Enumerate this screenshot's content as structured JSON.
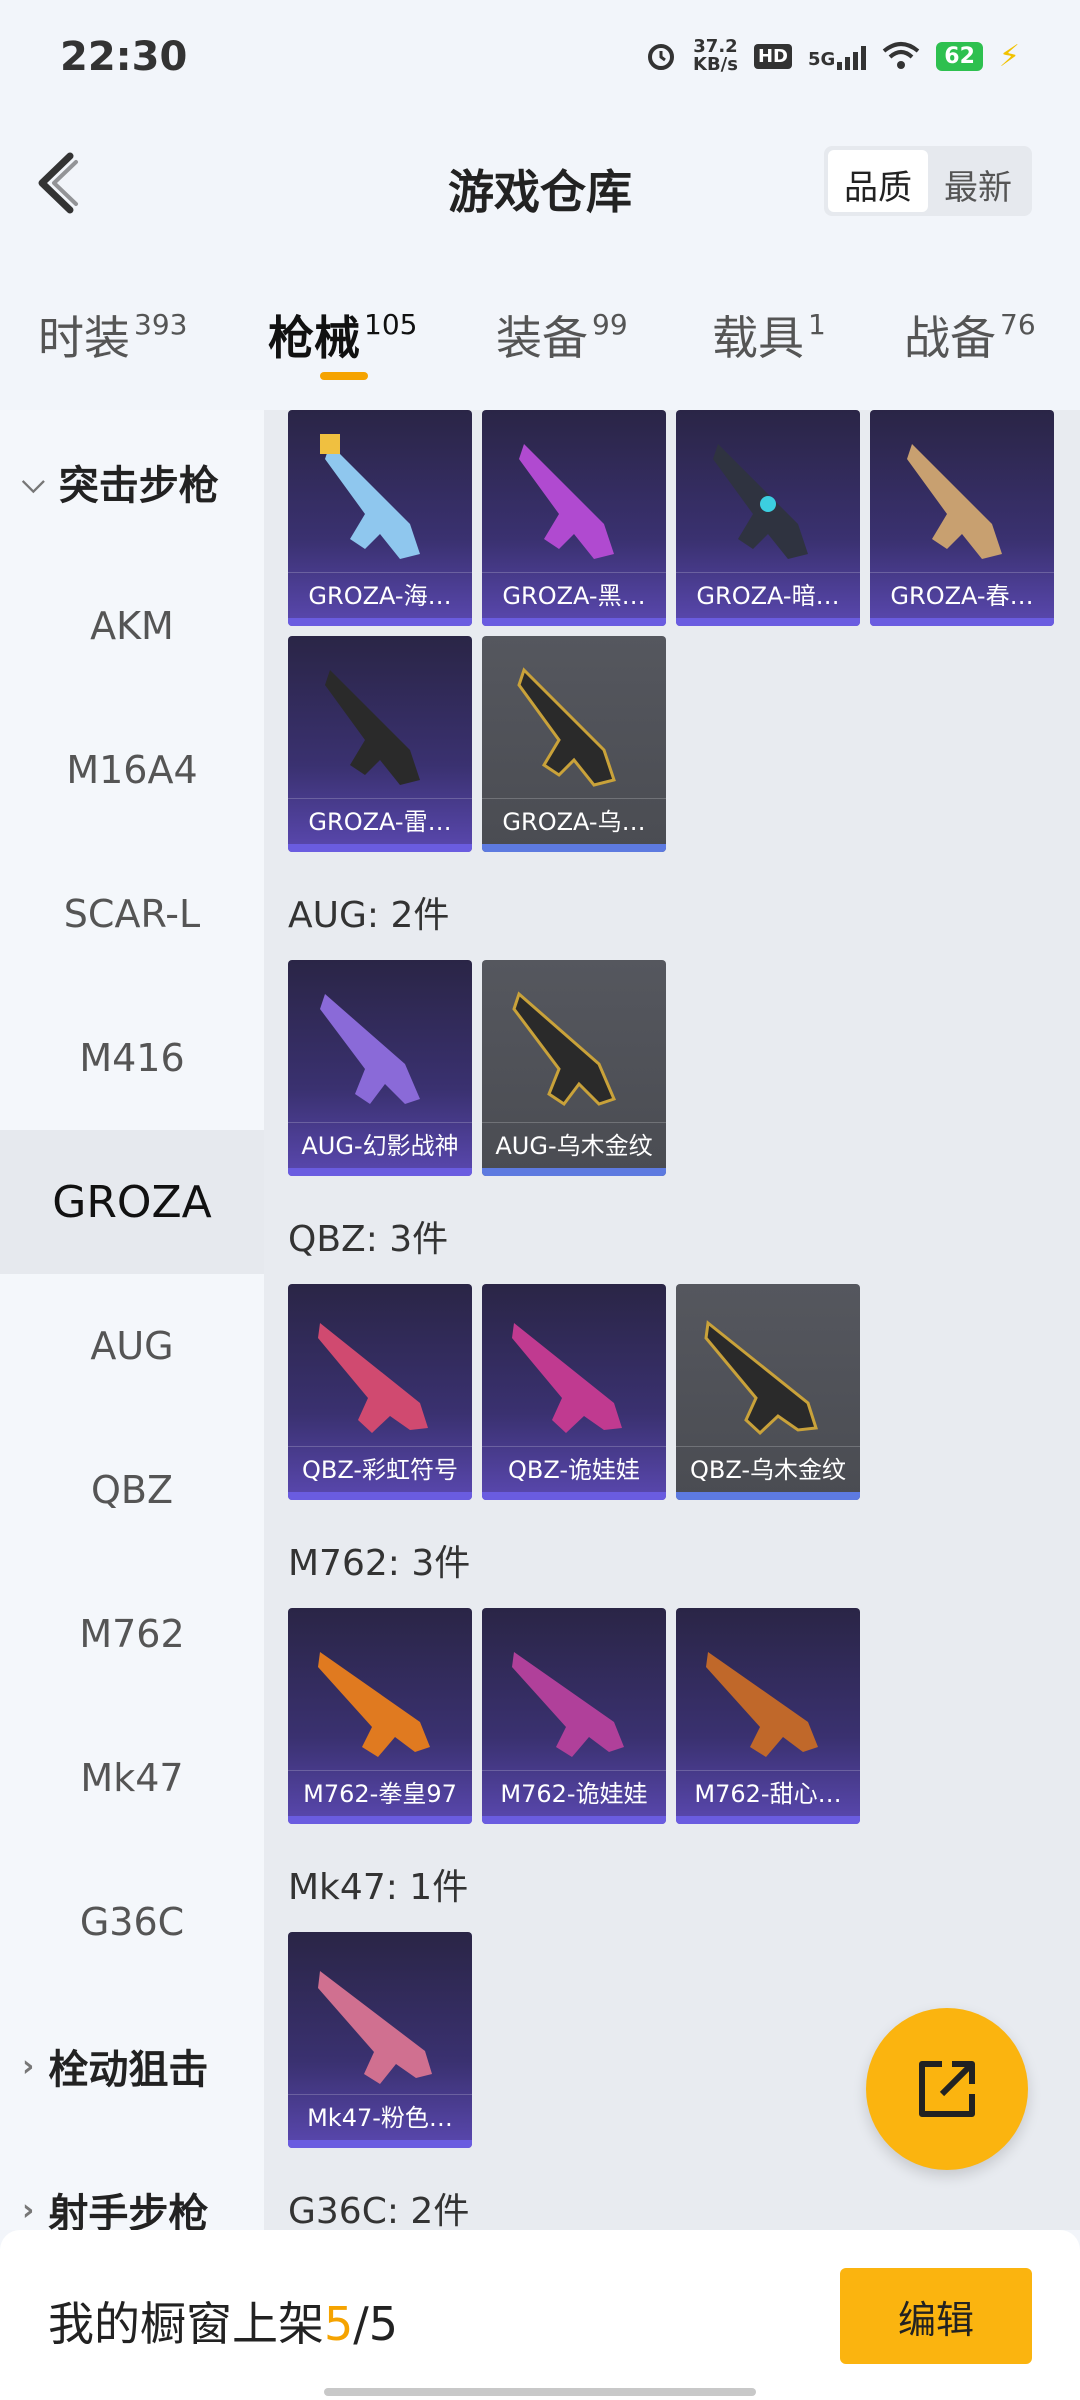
{
  "status": {
    "time": "22:30",
    "net_speed_value": "37.2",
    "net_speed_unit": "KB/s",
    "hd": "HD",
    "network": "5G",
    "battery": "62"
  },
  "header": {
    "title": "游戏仓库",
    "sort_options": [
      "品质",
      "最新"
    ],
    "sort_selected": "品质"
  },
  "tabs": [
    {
      "label": "时装",
      "count": "393"
    },
    {
      "label": "枪械",
      "count": "105"
    },
    {
      "label": "装备",
      "count": "99"
    },
    {
      "label": "载具",
      "count": "1"
    },
    {
      "label": "战备",
      "count": "76"
    }
  ],
  "sidebar": {
    "groups": {
      "assault": "突击步枪",
      "bolt": "栓动狙击",
      "marksman": "射手步枪"
    },
    "items": [
      "AKM",
      "M16A4",
      "SCAR-L",
      "M416",
      "GROZA",
      "AUG",
      "QBZ",
      "M762",
      "Mk47",
      "G36C"
    ],
    "selected": "GROZA"
  },
  "sections": {
    "groza": {
      "cards": [
        "GROZA-海…",
        "GROZA-黑…",
        "GROZA-暗…",
        "GROZA-春…",
        "GROZA-雷…",
        "GROZA-乌…"
      ]
    },
    "aug": {
      "label": "AUG: 2件",
      "cards": [
        "AUG-幻影战神",
        "AUG-乌木金纹"
      ]
    },
    "qbz": {
      "label": "QBZ: 3件",
      "cards": [
        "QBZ-彩虹符号",
        "QBZ-诡娃娃",
        "QBZ-乌木金纹"
      ]
    },
    "m762": {
      "label": "M762: 3件",
      "cards": [
        "M762-拳皇97",
        "M762-诡娃娃",
        "M762-甜心…"
      ]
    },
    "mk47": {
      "label": "Mk47: 1件",
      "cards": [
        "Mk47-粉色…"
      ]
    },
    "g36c": {
      "label": "G36C: 2件"
    }
  },
  "bottom": {
    "showcase_prefix": "我的橱窗上架",
    "showcase_count": "5",
    "showcase_sep": "/",
    "showcase_total": "5",
    "edit_label": "编辑"
  },
  "colors": {
    "accent": "#fbb40f",
    "card_purple": "#3a3170",
    "card_grey": "#4a4c52"
  }
}
